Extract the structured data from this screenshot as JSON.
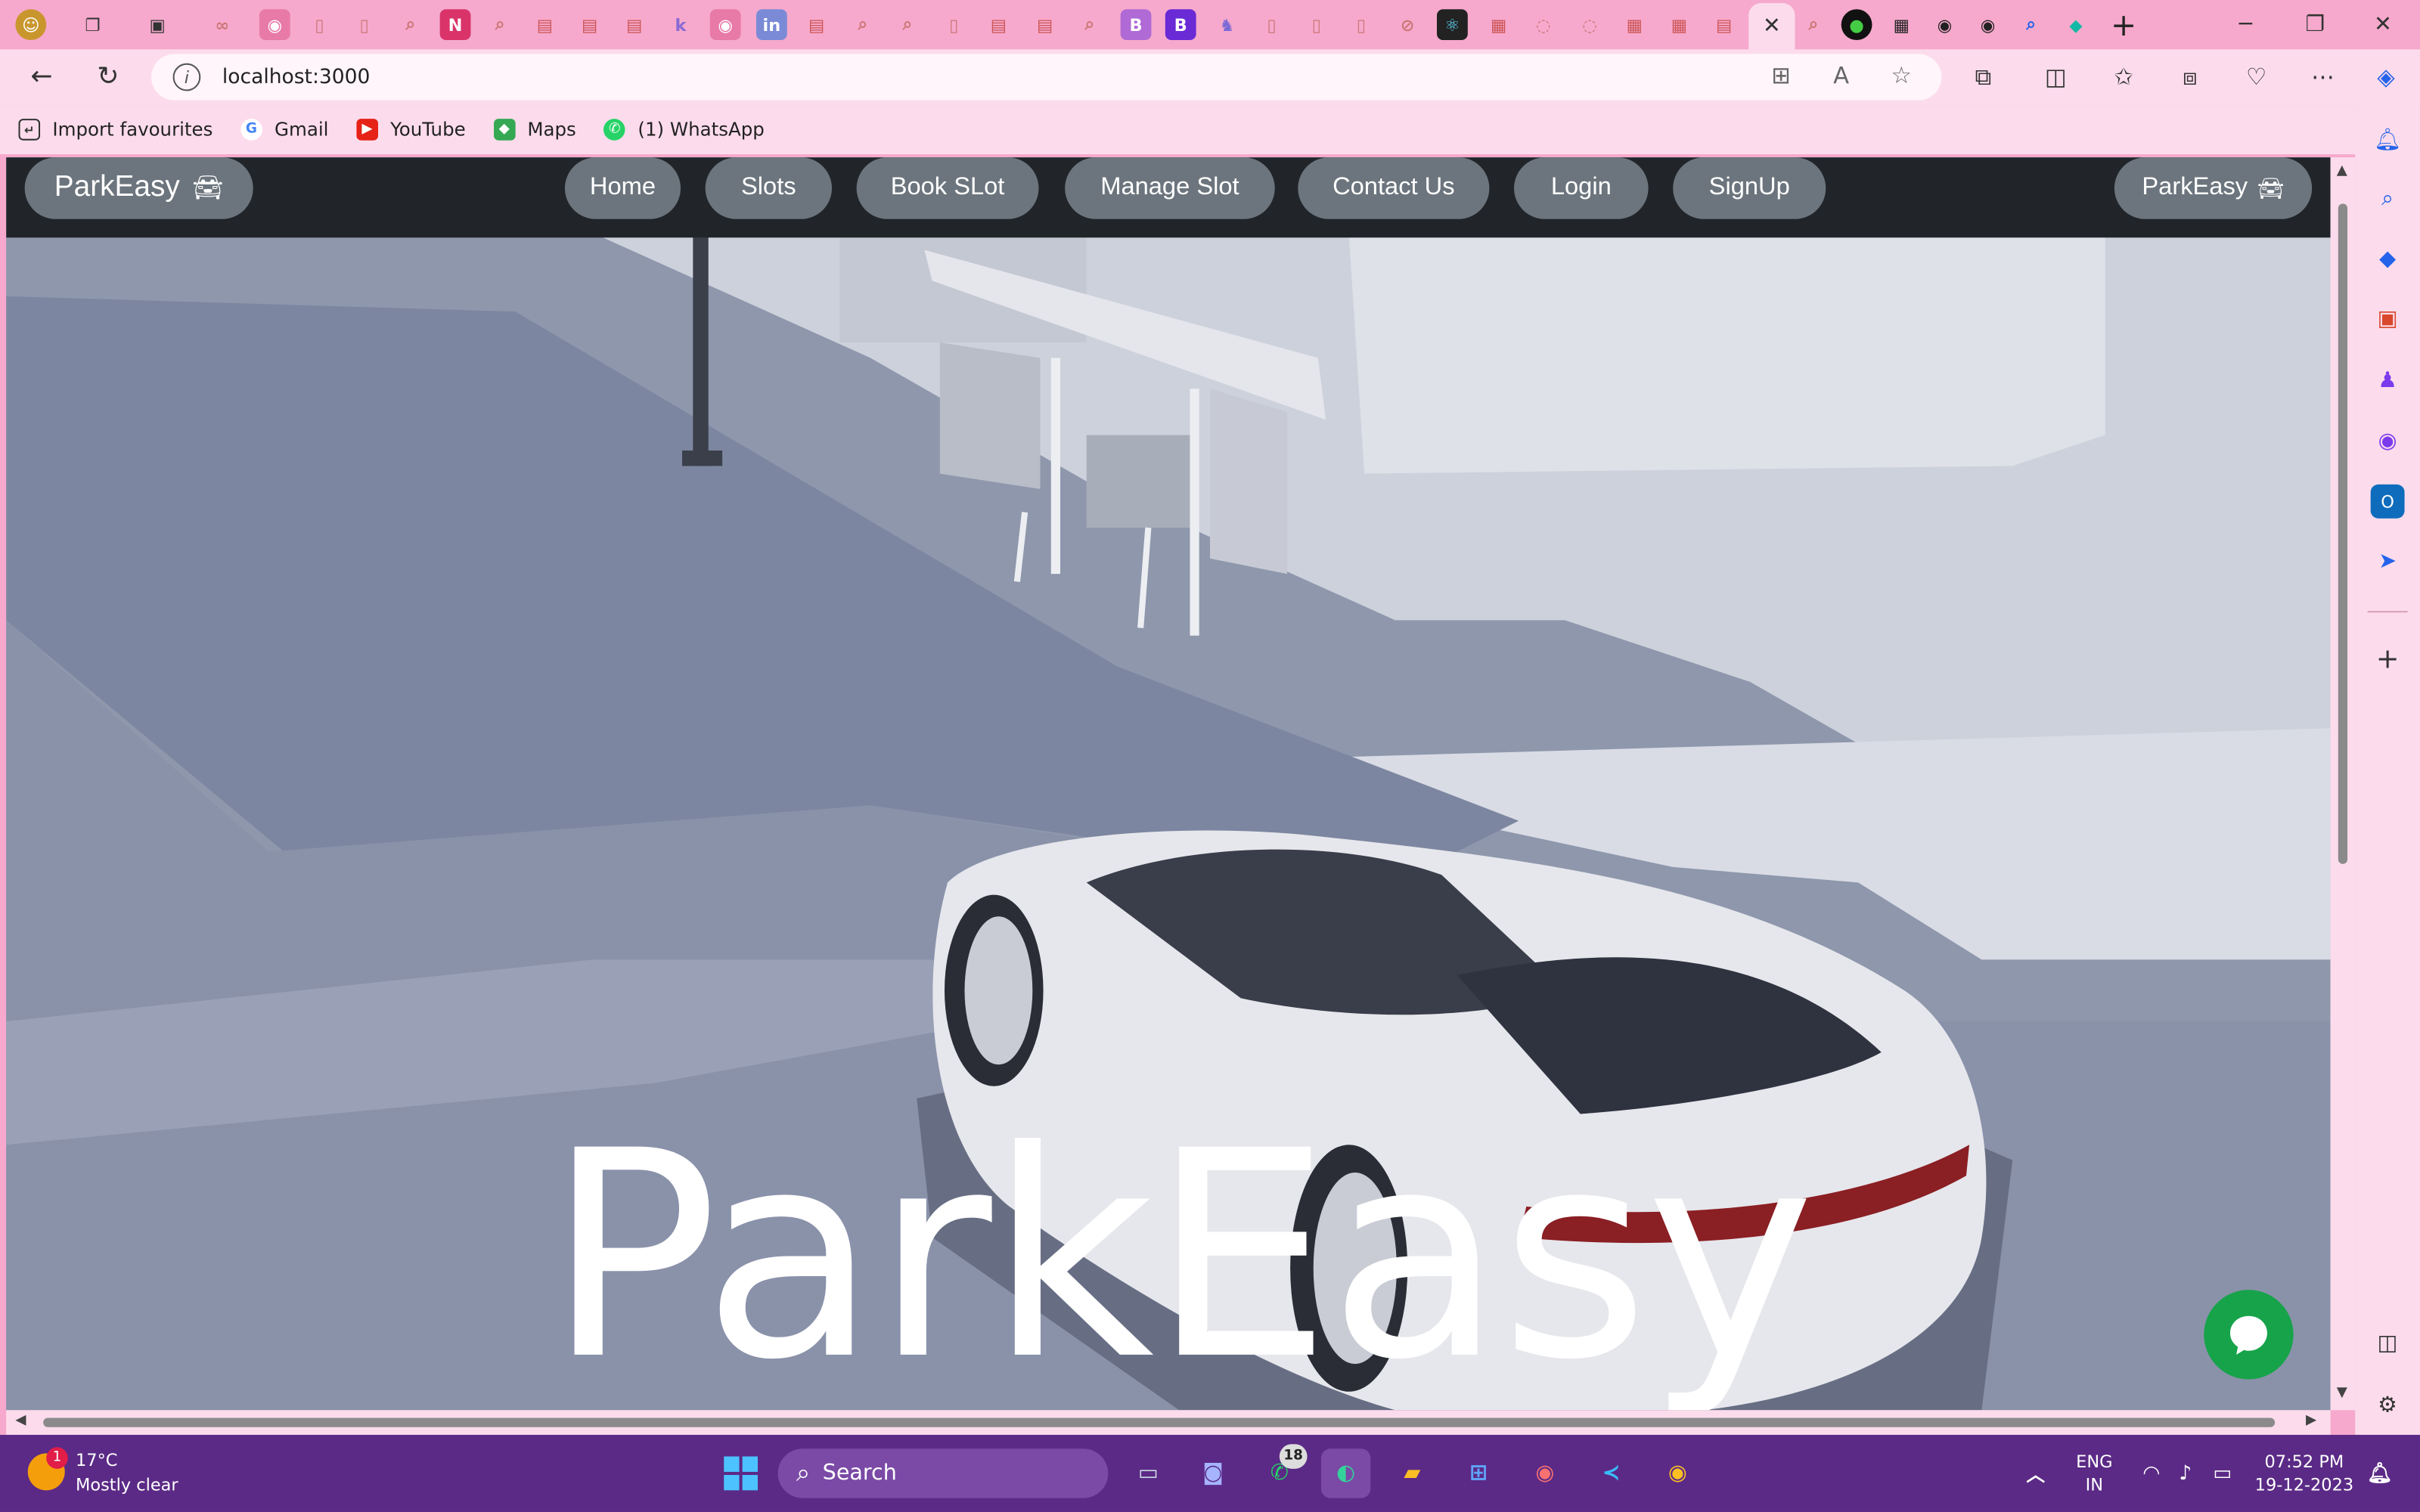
{
  "browser": {
    "url": "localhost:3000",
    "close_tab": "✕",
    "new_tab": "+",
    "favourites": [
      {
        "label": "Import favourites",
        "icon": "import-icon"
      },
      {
        "label": "Gmail",
        "icon": "google-icon"
      },
      {
        "label": "YouTube",
        "icon": "youtube-icon"
      },
      {
        "label": "Maps",
        "icon": "maps-icon"
      },
      {
        "label": "(1) WhatsApp",
        "icon": "whatsapp-icon"
      }
    ]
  },
  "site": {
    "brand_left": "ParkEasy",
    "brand_right": "ParkEasy",
    "nav": [
      "Home",
      "Slots",
      "Book SLot",
      "Manage Slot",
      "Contact Us",
      "Login",
      "SignUp"
    ],
    "hero_title": "ParkEasy"
  },
  "taskbar": {
    "weather_temp": "17°C",
    "weather_desc": "Mostly clear",
    "weather_badge": "1",
    "search_label": "Search",
    "whatsapp_badge": "18",
    "lang_line1": "ENG",
    "lang_line2": "IN",
    "time": "07:52 PM",
    "date": "19-12-2023"
  },
  "colors": {
    "navbar_bg": "#212529",
    "pill_bg": "#6c757d",
    "chat_button": "#17a34a",
    "browser_chrome": "#f6a9cc",
    "taskbar_bg": "#5b2a86"
  }
}
